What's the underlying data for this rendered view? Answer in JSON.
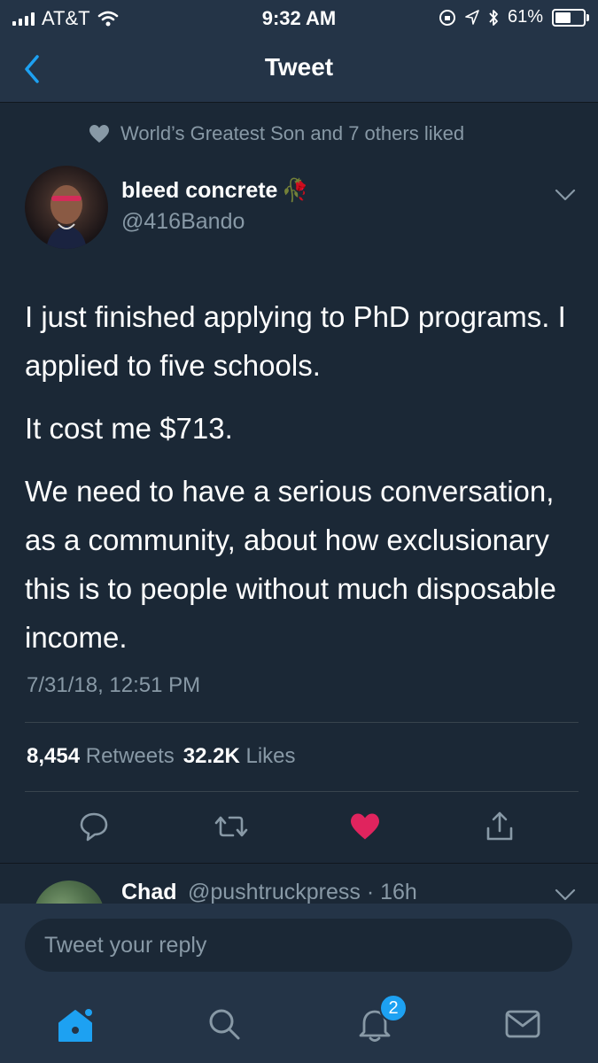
{
  "status_bar": {
    "carrier": "AT&T",
    "time": "9:32 AM",
    "battery": "61%",
    "battery_level": 0.61
  },
  "nav": {
    "title": "Tweet"
  },
  "social_context": "World’s Greatest Son and 7 others liked",
  "tweet": {
    "author_name": "bleed concrete",
    "author_emoji": "🥀",
    "author_handle": "@416Bando",
    "paragraphs": [
      "I just finished applying to PhD programs. I applied to five schools.",
      "It cost me $713.",
      "We need to have a serious conversation, as a community, about how exclusionary this is to people without much disposable income."
    ],
    "timestamp": "7/31/18, 12:51 PM",
    "retweets_count": "8,454",
    "retweets_label": "Retweets",
    "likes_count": "32.2K",
    "likes_label": "Likes"
  },
  "reply": {
    "name": "Chad",
    "handle": "@pushtruckpress · 16h"
  },
  "composer": {
    "placeholder": "Tweet your reply"
  },
  "tab_bar": {
    "notifications_badge": "2"
  },
  "colors": {
    "background": "#1b2836",
    "bar": "#243447",
    "muted": "#8899a6",
    "accent": "#1da1f2",
    "like": "#e0245e"
  },
  "icons": [
    "back-chevron-icon",
    "heart-icon",
    "chevron-down-icon",
    "reply-icon",
    "retweet-icon",
    "like-heart-icon",
    "share-icon",
    "home-icon",
    "search-icon",
    "bell-icon",
    "mail-icon"
  ]
}
